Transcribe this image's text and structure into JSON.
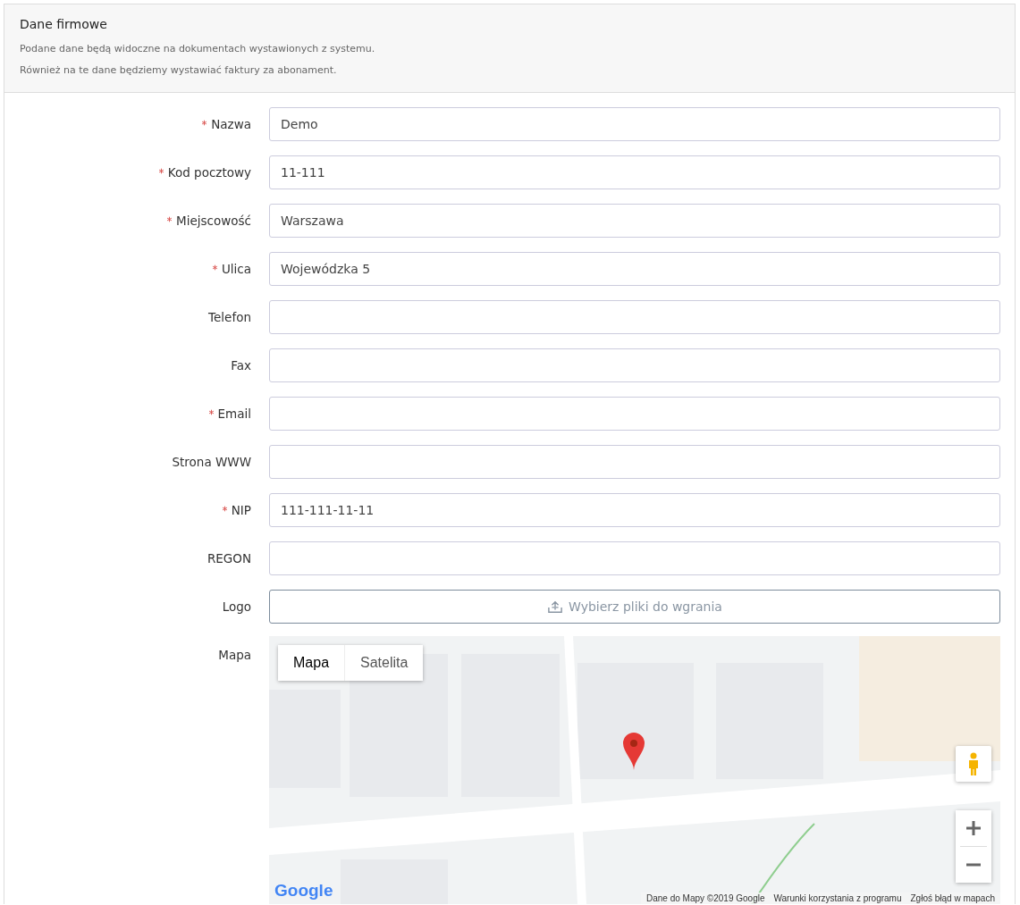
{
  "panel": {
    "title": "Dane firmowe",
    "notes": [
      "Podane dane będą widoczne na dokumentach wystawionych z systemu.",
      "Również na te dane będziemy wystawiać faktury za abonament."
    ]
  },
  "fields": [
    {
      "kind": "text",
      "label": "Nazwa",
      "required": true,
      "value": "Demo"
    },
    {
      "kind": "text",
      "label": "Kod pocztowy",
      "required": true,
      "value": "11-111"
    },
    {
      "kind": "text",
      "label": "Miejscowość",
      "required": true,
      "value": "Warszawa"
    },
    {
      "kind": "text",
      "label": "Ulica",
      "required": true,
      "value": "Wojewódzka 5"
    },
    {
      "kind": "text",
      "label": "Telefon",
      "required": false
    },
    {
      "kind": "text",
      "label": "Fax",
      "required": false
    },
    {
      "kind": "text",
      "label": "Email",
      "required": true
    },
    {
      "kind": "text",
      "label": "Strona WWW",
      "required": false
    },
    {
      "kind": "text",
      "label": "NIP",
      "required": true,
      "value": "111-111-11-11"
    },
    {
      "kind": "text",
      "label": "REGON",
      "required": false
    },
    {
      "kind": "file",
      "label": "Logo",
      "required": false,
      "button": "Wybierz pliki do wgrania"
    },
    {
      "kind": "map",
      "label": "Mapa",
      "required": false
    }
  ],
  "map": {
    "types": [
      {
        "label": "Mapa",
        "selected": true
      },
      {
        "label": "Satelita",
        "selected": false
      }
    ],
    "logo": "Google",
    "attribution": [
      "Dane do Mapy ©2019 Google",
      "Warunki korzystania z programu",
      "Zgłoś błąd w mapach"
    ]
  }
}
